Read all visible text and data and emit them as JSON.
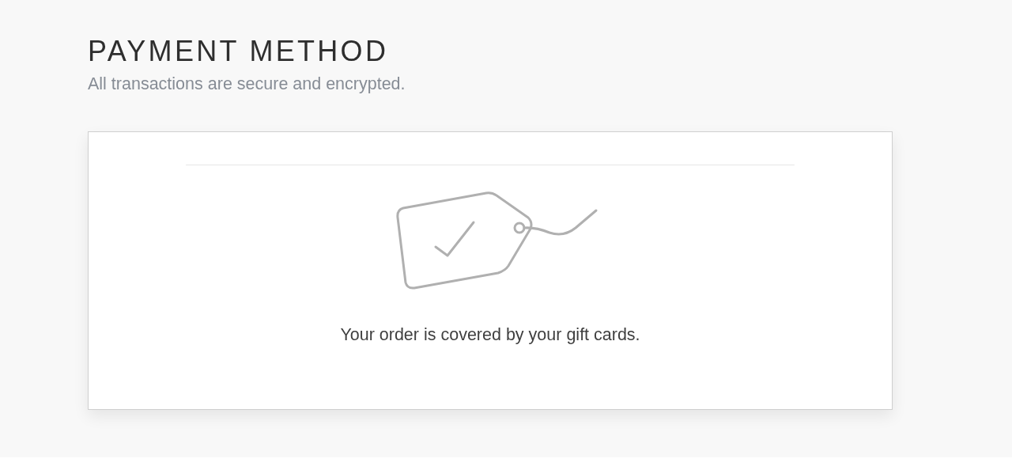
{
  "section": {
    "title": "PAYMENT METHOD",
    "subtitle": "All transactions are secure and encrypted."
  },
  "card": {
    "message": "Your order is covered by your gift cards."
  }
}
